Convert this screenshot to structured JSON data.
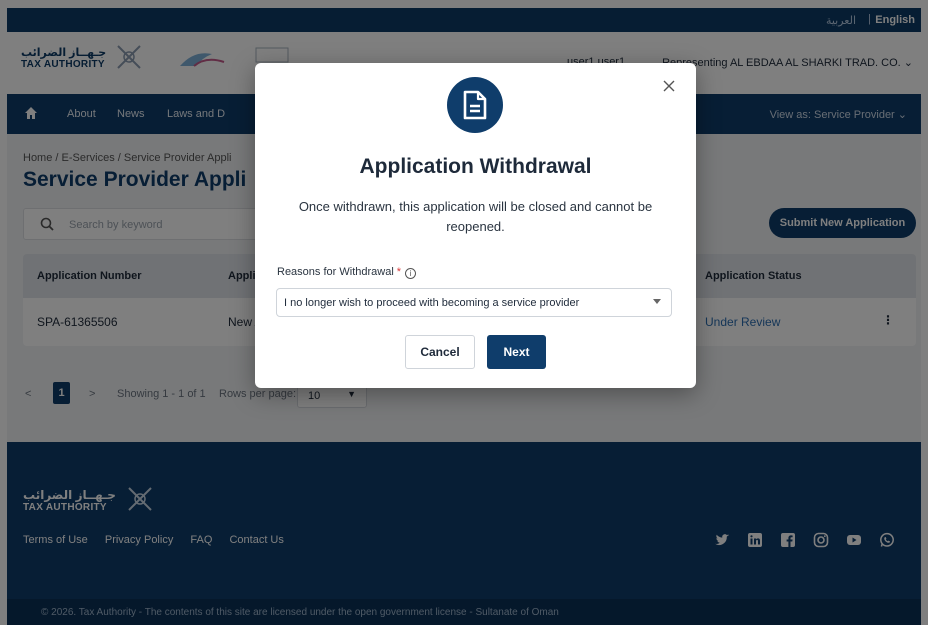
{
  "topbar": {
    "arabic_label": "العربية",
    "separator": "|",
    "english_label": "English"
  },
  "header": {
    "logo_ar": "جـهــاز الضرائب",
    "logo_en": "TAX AUTHORITY",
    "user_name": "user1 user1",
    "representing": "Representing AL EBDAA AL SHARKI TRAD. CO."
  },
  "nav": {
    "items": [
      "About",
      "News",
      "Laws and D"
    ],
    "view_as": "View as: Service Provider"
  },
  "page": {
    "breadcrumb": "Home / E-Services / Service Provider Appli",
    "title": "Service Provider Appli",
    "search_placeholder": "Search by keyword",
    "submit_button": "Submit New Application"
  },
  "table": {
    "headers": [
      "Application Number",
      "Applic",
      "Application Status"
    ],
    "rows": [
      {
        "number": "SPA-61365506",
        "type": "New A",
        "status": "Under Review"
      }
    ]
  },
  "pagination": {
    "prev": "<",
    "current_page": "1",
    "next": ">",
    "showing": "Showing 1 - 1 of 1",
    "rows_label": "Rows per page:",
    "rows_value": "10"
  },
  "footer": {
    "logo_ar": "جـهــاز الضرائب",
    "logo_en": "TAX AUTHORITY",
    "links": [
      "Terms of Use",
      "Privacy Policy",
      "FAQ",
      "Contact Us"
    ],
    "social_icons": [
      "twitter-icon",
      "linkedin-icon",
      "facebook-icon",
      "instagram-icon",
      "youtube-icon",
      "whatsapp-icon"
    ],
    "copyright": "© 2026. Tax Authority - The contents of this site are licensed under the open government license - Sultanate of Oman"
  },
  "modal": {
    "title": "Application Withdrawal",
    "message": "Once withdrawn, this application will be closed and cannot be reopened.",
    "field_label": "Reasons for Withdrawal",
    "required_mark": "*",
    "selected_reason": "I no longer wish to proceed with becoming a service provider",
    "cancel_label": "Cancel",
    "next_label": "Next"
  },
  "colors": {
    "brand": "#0f3d6b",
    "status": "#2b6cb0",
    "required": "#d93b3b"
  }
}
